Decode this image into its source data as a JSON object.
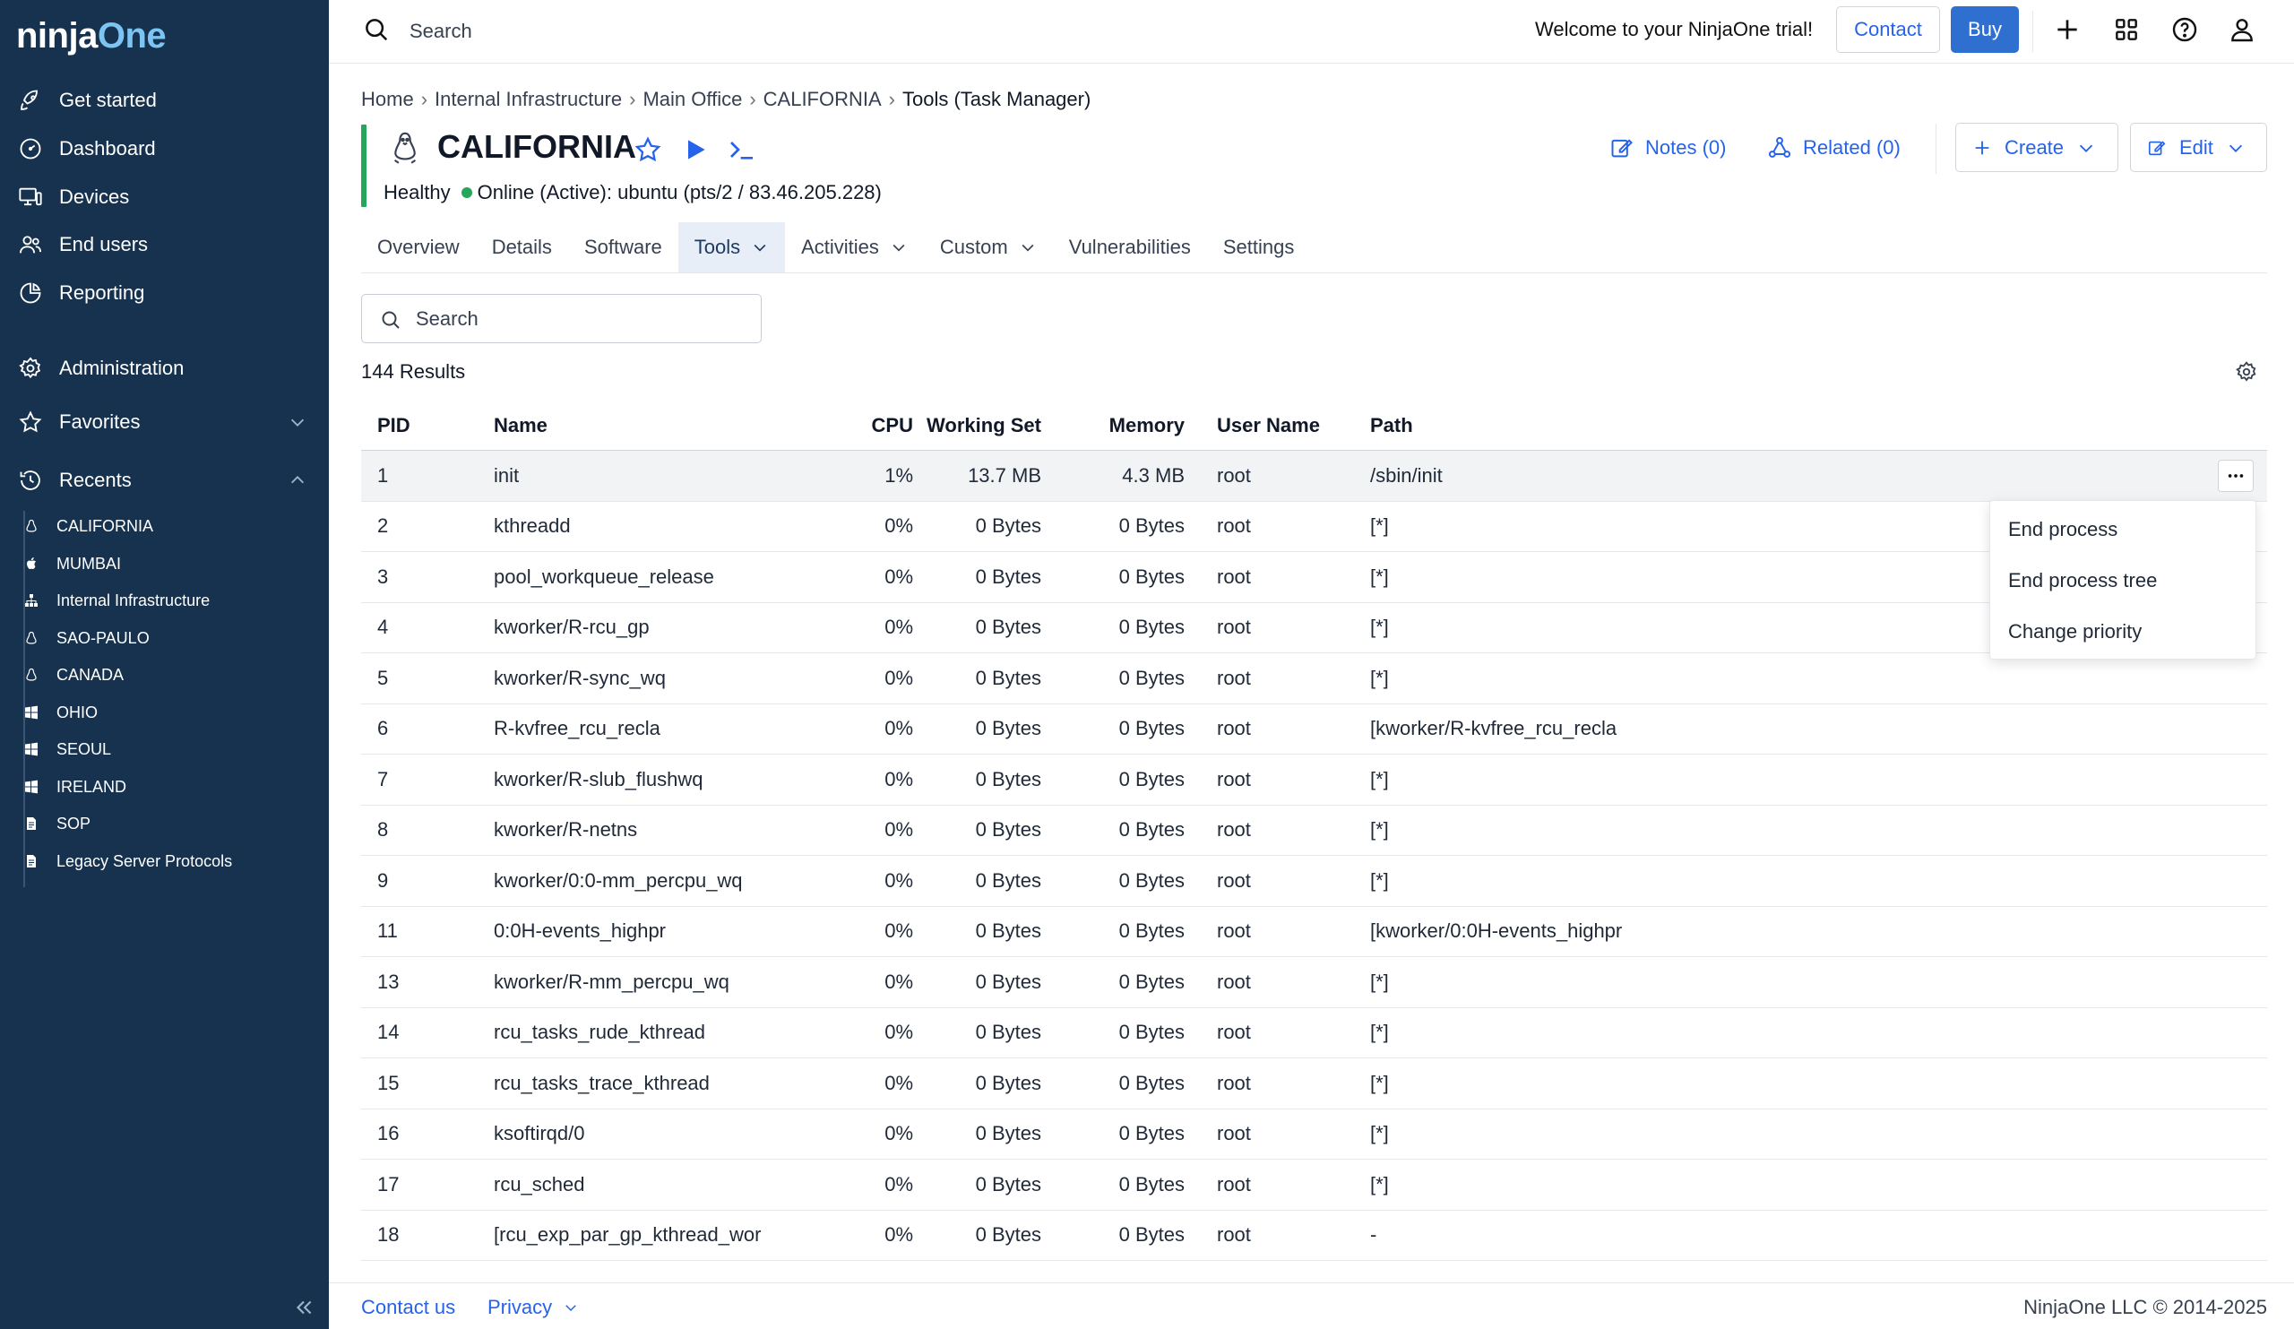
{
  "sidebar": {
    "logo": {
      "main": "ninja",
      "accent": "One"
    },
    "nav": [
      {
        "label": "Get started",
        "icon": "rocket-icon"
      },
      {
        "label": "Dashboard",
        "icon": "dashboard-gauge-icon"
      },
      {
        "label": "Devices",
        "icon": "devices-icon"
      },
      {
        "label": "End users",
        "icon": "users-icon"
      },
      {
        "label": "Reporting",
        "icon": "chart-icon"
      },
      {
        "label": "Administration",
        "icon": "gear-icon"
      },
      {
        "label": "Favorites",
        "icon": "star-icon"
      },
      {
        "label": "Recents",
        "icon": "history-icon"
      }
    ],
    "recents": [
      {
        "label": "CALIFORNIA",
        "icon": "linux-icon"
      },
      {
        "label": "MUMBAI",
        "icon": "apple-icon"
      },
      {
        "label": "Internal Infrastructure",
        "icon": "org-icon"
      },
      {
        "label": "SAO-PAULO",
        "icon": "linux-icon"
      },
      {
        "label": "CANADA",
        "icon": "linux-icon"
      },
      {
        "label": "OHIO",
        "icon": "windows-icon"
      },
      {
        "label": "SEOUL",
        "icon": "windows-icon"
      },
      {
        "label": "IRELAND",
        "icon": "windows-icon"
      },
      {
        "label": "SOP",
        "icon": "document-icon"
      },
      {
        "label": "Legacy Server Protocols",
        "icon": "document-icon"
      }
    ]
  },
  "topbar": {
    "search_placeholder": "Search",
    "welcome": "Welcome to your NinjaOne trial!",
    "contact": "Contact",
    "buy": "Buy"
  },
  "breadcrumb": [
    "Home",
    "Internal Infrastructure",
    "Main Office",
    "CALIFORNIA",
    "Tools (Task Manager)"
  ],
  "device": {
    "name": "CALIFORNIA",
    "health": "Healthy",
    "status": "Online (Active): ubuntu (pts/2 / 83.46.205.228)",
    "notes": "Notes (0)",
    "related": "Related (0)",
    "create": "Create",
    "edit": "Edit"
  },
  "tabs": [
    "Overview",
    "Details",
    "Software",
    "Tools",
    "Activities",
    "Custom",
    "Vulnerabilities",
    "Settings"
  ],
  "active_tab": "Tools",
  "filter": {
    "placeholder": "Search"
  },
  "results": "144 Results",
  "table": {
    "columns": [
      "PID",
      "Name",
      "CPU",
      "Working Set",
      "Memory",
      "User Name",
      "Path"
    ],
    "rows": [
      [
        "1",
        "init",
        "1%",
        "13.7 MB",
        "4.3 MB",
        "root",
        "/sbin/init"
      ],
      [
        "2",
        "kthreadd",
        "0%",
        "0 Bytes",
        "0 Bytes",
        "root",
        "[*]"
      ],
      [
        "3",
        "pool_workqueue_release",
        "0%",
        "0 Bytes",
        "0 Bytes",
        "root",
        "[*]"
      ],
      [
        "4",
        "kworker/R-rcu_gp",
        "0%",
        "0 Bytes",
        "0 Bytes",
        "root",
        "[*]"
      ],
      [
        "5",
        "kworker/R-sync_wq",
        "0%",
        "0 Bytes",
        "0 Bytes",
        "root",
        "[*]"
      ],
      [
        "6",
        "R-kvfree_rcu_recla",
        "0%",
        "0 Bytes",
        "0 Bytes",
        "root",
        "[kworker/R-kvfree_rcu_recla"
      ],
      [
        "7",
        "kworker/R-slub_flushwq",
        "0%",
        "0 Bytes",
        "0 Bytes",
        "root",
        "[*]"
      ],
      [
        "8",
        "kworker/R-netns",
        "0%",
        "0 Bytes",
        "0 Bytes",
        "root",
        "[*]"
      ],
      [
        "9",
        "kworker/0:0-mm_percpu_wq",
        "0%",
        "0 Bytes",
        "0 Bytes",
        "root",
        "[*]"
      ],
      [
        "11",
        "0:0H-events_highpr",
        "0%",
        "0 Bytes",
        "0 Bytes",
        "root",
        "[kworker/0:0H-events_highpr"
      ],
      [
        "13",
        "kworker/R-mm_percpu_wq",
        "0%",
        "0 Bytes",
        "0 Bytes",
        "root",
        "[*]"
      ],
      [
        "14",
        "rcu_tasks_rude_kthread",
        "0%",
        "0 Bytes",
        "0 Bytes",
        "root",
        "[*]"
      ],
      [
        "15",
        "rcu_tasks_trace_kthread",
        "0%",
        "0 Bytes",
        "0 Bytes",
        "root",
        "[*]"
      ],
      [
        "16",
        "ksoftirqd/0",
        "0%",
        "0 Bytes",
        "0 Bytes",
        "root",
        "[*]"
      ],
      [
        "17",
        "rcu_sched",
        "0%",
        "0 Bytes",
        "0 Bytes",
        "root",
        "[*]"
      ],
      [
        "18",
        "[rcu_exp_par_gp_kthread_wor",
        "0%",
        "0 Bytes",
        "0 Bytes",
        "root",
        "-"
      ]
    ]
  },
  "context_menu": [
    "End process",
    "End process tree",
    "Change priority"
  ],
  "footer": {
    "contact": "Contact us",
    "privacy": "Privacy",
    "copyright": "NinjaOne LLC © 2014-2025"
  },
  "colors": {
    "sidebar_bg": "#16324f",
    "accent_blue": "#2563eb",
    "buy_button": "#2f6fcf",
    "status_green": "#26a65b",
    "active_tab_bg": "#e8eef8"
  }
}
